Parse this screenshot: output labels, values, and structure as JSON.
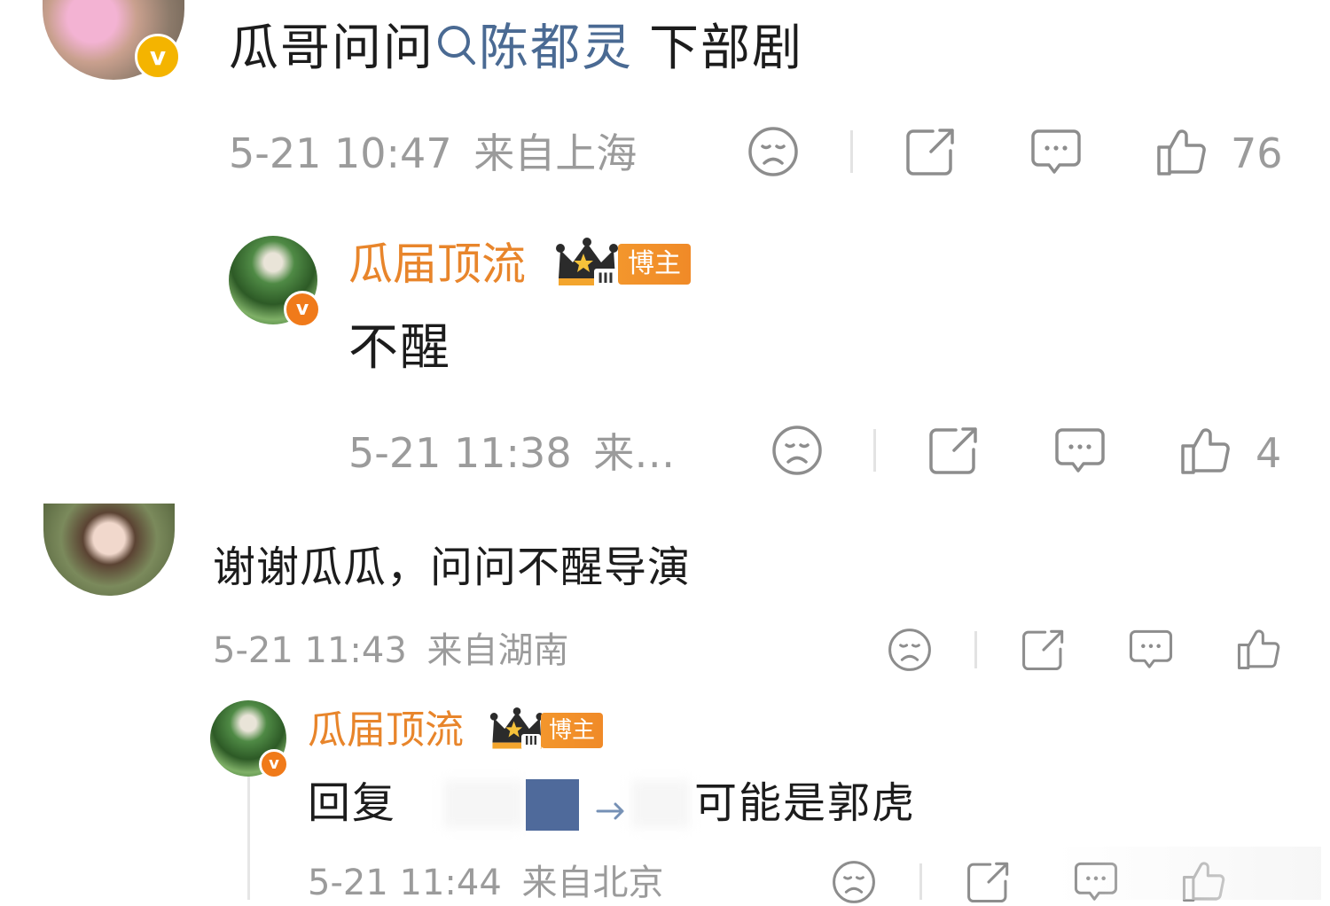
{
  "comments": [
    {
      "text_prefix": "瓜哥问问",
      "mention": "陈都灵",
      "text_suffix": "下部剧",
      "time": "5-21 10:47",
      "location": "来自上海",
      "likes": "76"
    },
    {
      "author": "瓜届顶流",
      "badge": "博主",
      "crown_level": "III",
      "text": "不醒",
      "time": "5-21 11:38",
      "location": "来…",
      "likes": "4"
    },
    {
      "text": "谢谢瓜瓜，问问不醒导演",
      "time": "5-21 11:43",
      "location": "来自湖南"
    },
    {
      "author": "瓜届顶流",
      "badge": "博主",
      "crown_level": "III",
      "reply_label": "回复",
      "reply_text": "可能是郭虎",
      "time": "5-21 11:44",
      "location": "来自北京"
    }
  ],
  "icons": {
    "verified": "verified-v-icon",
    "search": "search-icon",
    "dislike": "sad-face-icon",
    "share": "share-icon",
    "comment": "comment-icon",
    "like": "thumbs-up-icon"
  },
  "colors": {
    "author_name": "#e8852b",
    "link": "#4a6a93",
    "meta": "#9b9b9b",
    "badge_bg": "#f08a28",
    "verified_gold": "#f4b400",
    "verified_orange": "#f07a1a"
  }
}
